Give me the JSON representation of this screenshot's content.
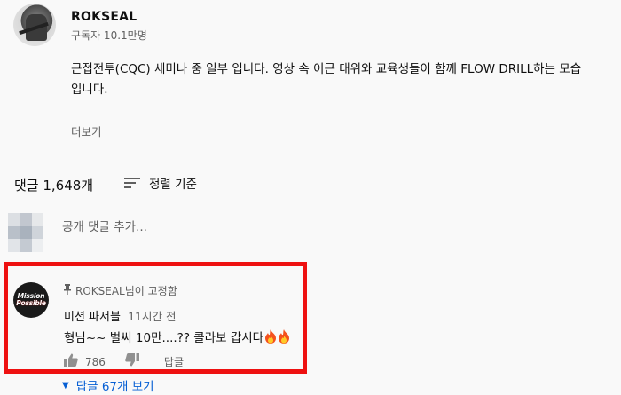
{
  "channel": {
    "name": "ROKSEAL",
    "subscribers": "구독자 10.1만명"
  },
  "video": {
    "description_line1": "근접전투(CQC) 세미나 중 일부 입니다. 영상 속 이근 대위와 교육생들이 함께 FLOW DRILL하는 모습",
    "description_line2": "입니다.",
    "show_more": "더보기"
  },
  "comments": {
    "count_label": "댓글 1,648개",
    "sort_label": "정렬 기준",
    "add_placeholder": "공개 댓글 추가...",
    "pinned": {
      "pinned_by": "ROKSEAL님이 고정함",
      "avatar_logo_line1": "Mission",
      "avatar_logo_line2": "Possible",
      "author": "미션 파서블",
      "time": "11시간 전",
      "text": "형님~~ 벌써 10만....?? 콜라보 갑시다",
      "likes": "786",
      "reply_label": "답글",
      "view_replies": "답글 67개 보기"
    }
  },
  "icons": {
    "pin": "pin-icon",
    "sort": "sort-icon",
    "like": "thumbs-up-icon",
    "dislike": "thumbs-down-icon",
    "flame": "fire-emoji-icon",
    "expand": "caret-down-icon"
  },
  "colors": {
    "highlight_border": "#ee1111",
    "link_blue": "#065fd4",
    "secondary_text": "#606060",
    "background": "#f9f9f9"
  }
}
